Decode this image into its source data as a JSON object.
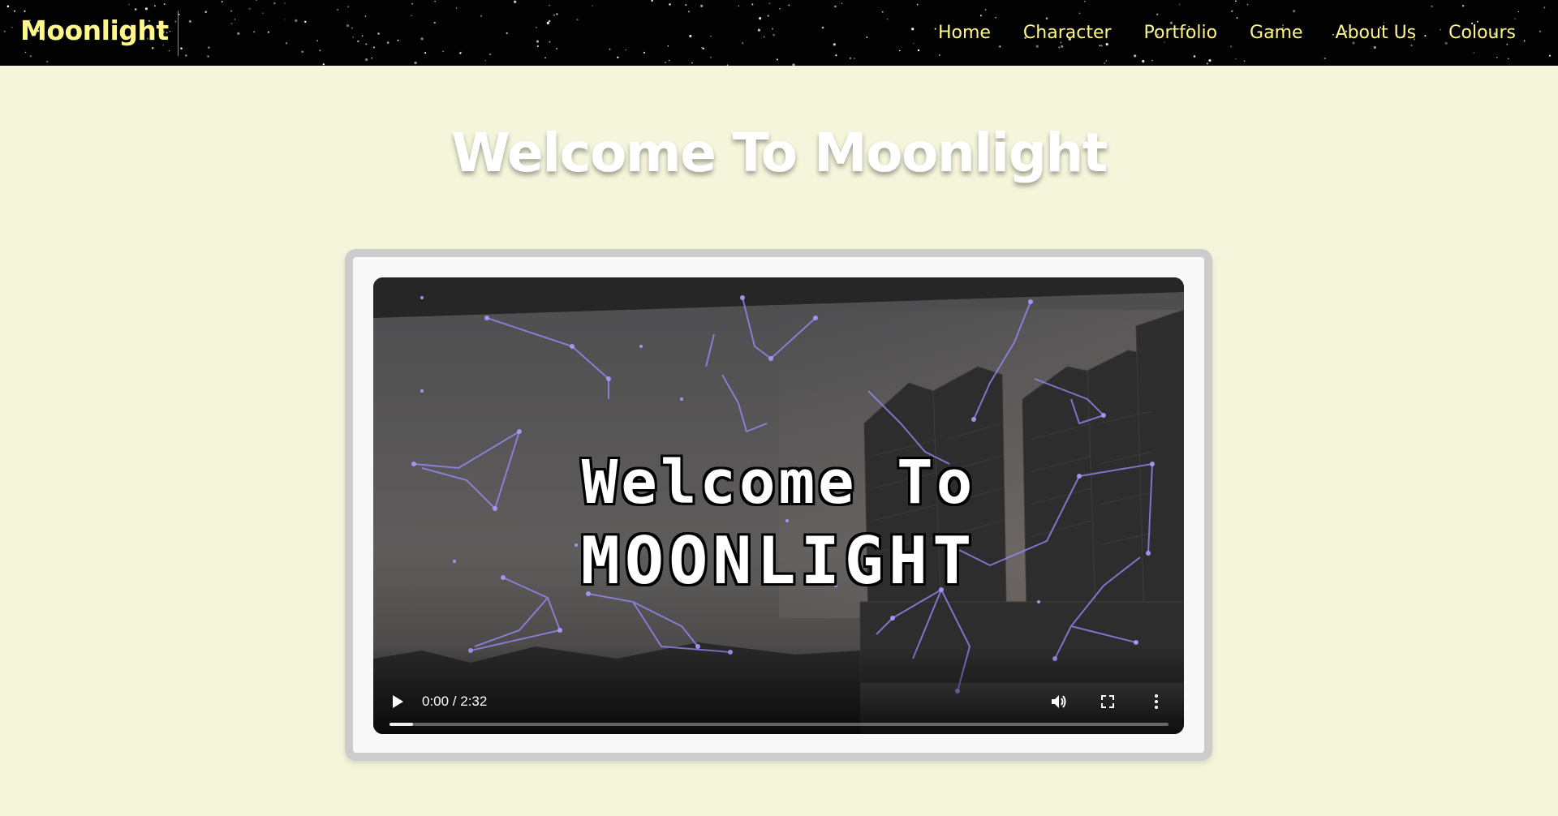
{
  "header": {
    "brand": "Moonlight",
    "nav": [
      {
        "label": "Home"
      },
      {
        "label": "Character"
      },
      {
        "label": "Portfolio"
      },
      {
        "label": "Game"
      },
      {
        "label": "About Us"
      },
      {
        "label": "Colours"
      }
    ]
  },
  "main": {
    "title": "Welcome To Moonlight"
  },
  "video": {
    "overlay_line1": "Welcome To",
    "overlay_line2": "MOONLIGHT",
    "time": "0:00 / 2:32",
    "progress_fraction": 0.03,
    "controls": {
      "play_icon": "play-icon",
      "volume_icon": "volume-icon",
      "fullscreen_icon": "fullscreen-icon",
      "more_icon": "more-options-icon"
    }
  },
  "colors": {
    "page_background": "#f5f5dc",
    "nav_background": "#020202",
    "nav_text": "#fff78a",
    "title_text": "#ffffff",
    "frame_border": "#cccccc",
    "constellation": "#9a8cff"
  }
}
